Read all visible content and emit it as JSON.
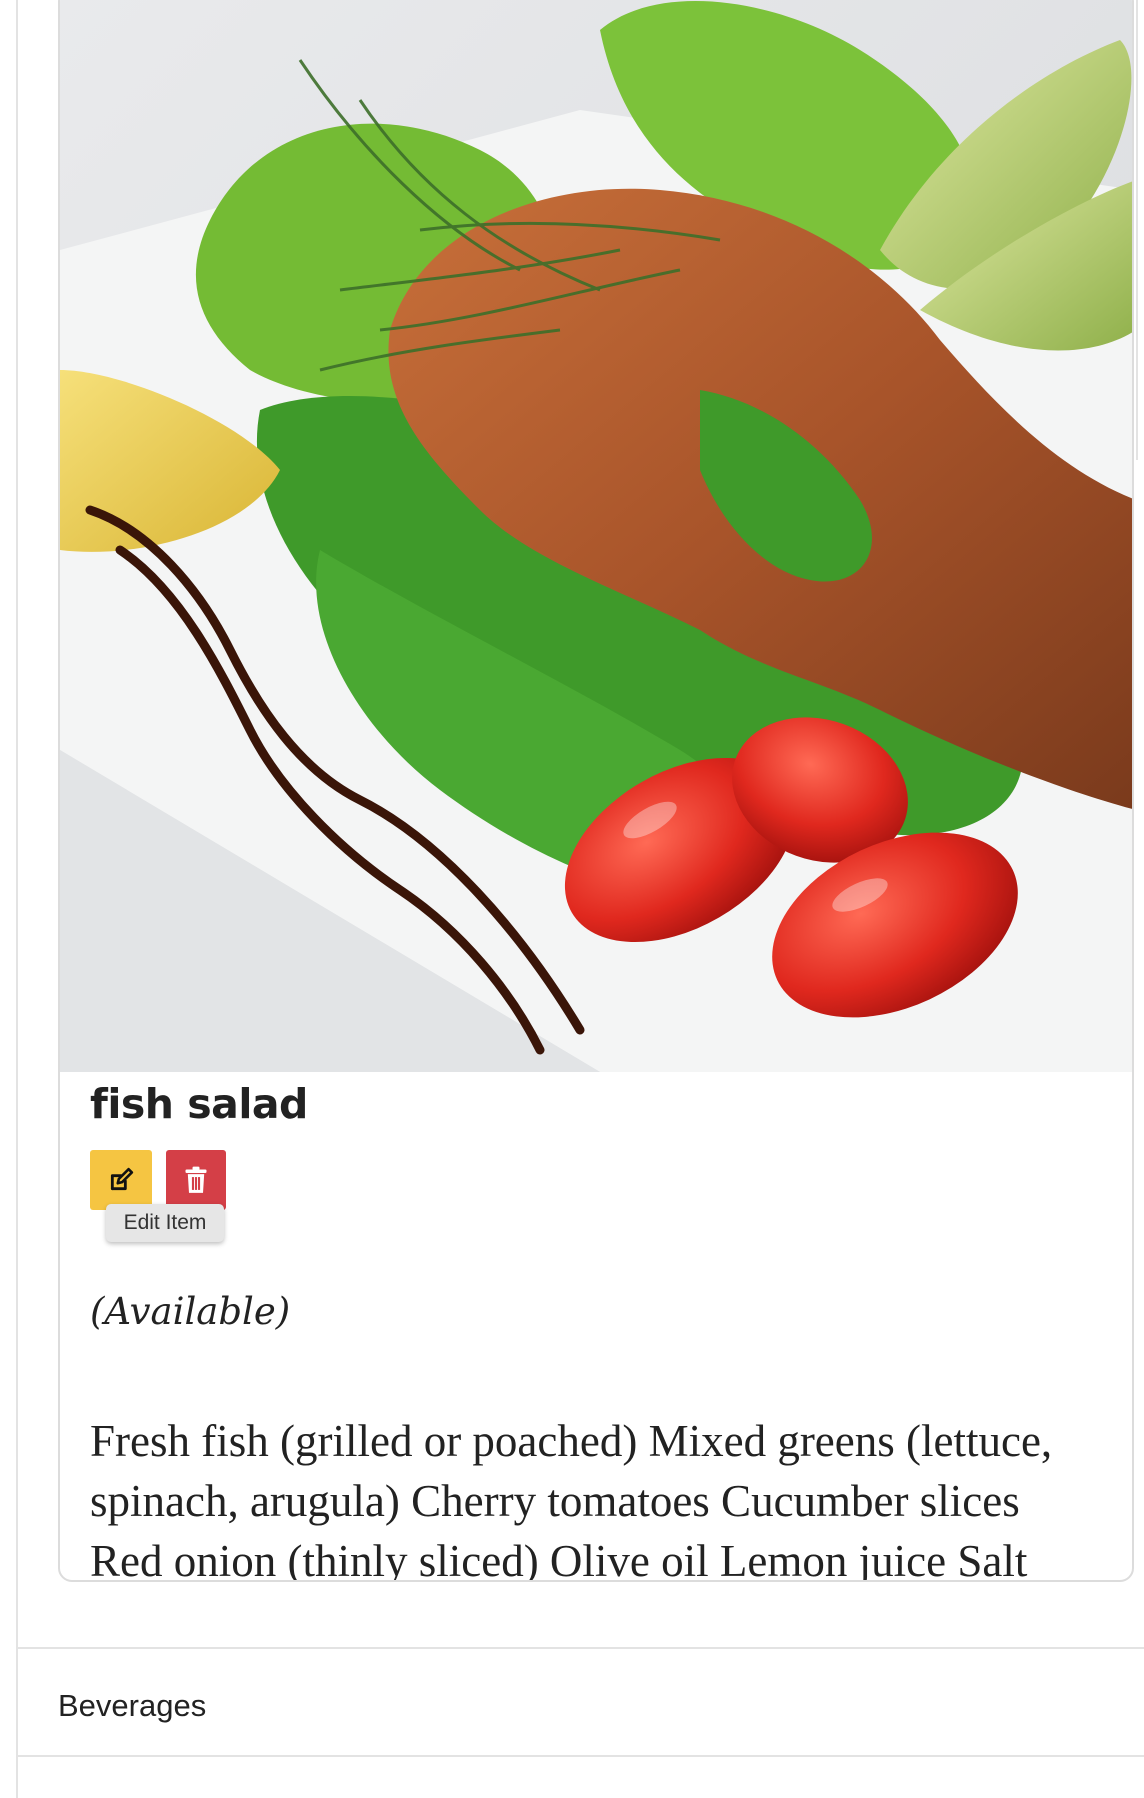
{
  "item": {
    "title": "fish salad",
    "availability": "(Available)",
    "description": "Fresh fish (grilled or poached) Mixed greens (lettuce, spinach, arugula) Cherry tomatoes Cucumber slices Red onion (thinly sliced) Olive oil Lemon juice Salt and",
    "image_icon": "grilled-fish-salad-photo"
  },
  "actions": {
    "edit_icon": "edit-icon",
    "delete_icon": "trash-icon",
    "edit_tooltip": "Edit Item"
  },
  "sections": {
    "next_category": "Beverages"
  },
  "colors": {
    "edit_button": "#f5c542",
    "delete_button": "#d43f47",
    "border": "#dcdcdc"
  }
}
